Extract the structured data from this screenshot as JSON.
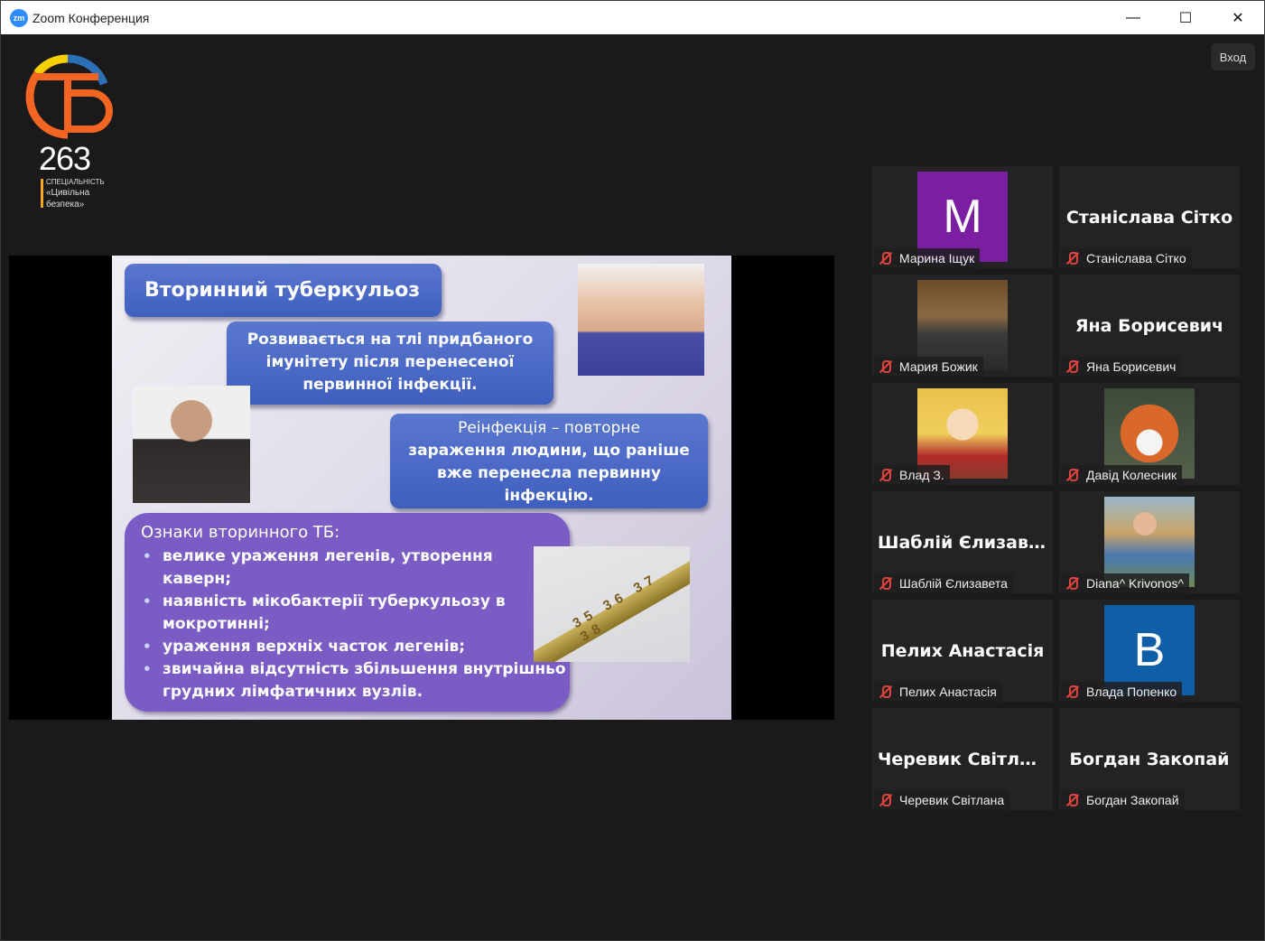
{
  "window": {
    "title": "Zoom Конференция",
    "icon_label": "zm",
    "minimize": "—",
    "maximize": "☐",
    "close": "✕"
  },
  "logo": {
    "number": "263",
    "line1": "СПЕЦІАЛЬНІСТЬ",
    "line2": "«Цивільна",
    "line3": "безпека»"
  },
  "signin_label": "Вход",
  "slide": {
    "title": "Вторинний туберкульоз",
    "box1": [
      "Розвивається на тлі придбаного",
      "імунітету  після перенесеної",
      "первинної інфекції."
    ],
    "box2_first": "Реінфекція – повторне",
    "box2_rest": [
      "зараження людини, що раніше",
      "вже перенесла первинну",
      "інфекцію."
    ],
    "signs_header": "Ознаки вторинного ТБ:",
    "signs": [
      "велике ураження легенів, утворення каверн;",
      "наявність мікобактерії туберкульозу в мокротинні;",
      "ураження  верхніх часток легенів;",
      "звичайна відсутність збільшення внутрішньо грудних лімфатичних вузлів."
    ],
    "thermo_nums": "35 36 37 38"
  },
  "participants": [
    {
      "name": "Марина Іщук",
      "avatar_letter": "M",
      "avatar_color": "#7b1fa2"
    },
    {
      "name": "Станіслава Сітко",
      "center": "Станіслава Сітко"
    },
    {
      "name": "Мария Божик",
      "photo": "person"
    },
    {
      "name": "Яна Борисевич",
      "center": "Яна Борисевич"
    },
    {
      "name": "Влад З.",
      "photo": "anime"
    },
    {
      "name": "Давід Колесник",
      "photo": "fox"
    },
    {
      "name": "Шаблій Єлизавета",
      "center": "Шаблій Єлизав..."
    },
    {
      "name": "Diana^ Krivonos^",
      "photo": "girl"
    },
    {
      "name": "Пелих Анастасія",
      "center": "Пелих Анастасія"
    },
    {
      "name": "Влада Попенко",
      "avatar_letter": "B",
      "avatar_color": "#0e5fa8"
    },
    {
      "name": "Черевик Світлана",
      "center": "Черевик Світла..."
    },
    {
      "name": "Богдан Закопай",
      "center": "Богдан Закопай"
    }
  ]
}
